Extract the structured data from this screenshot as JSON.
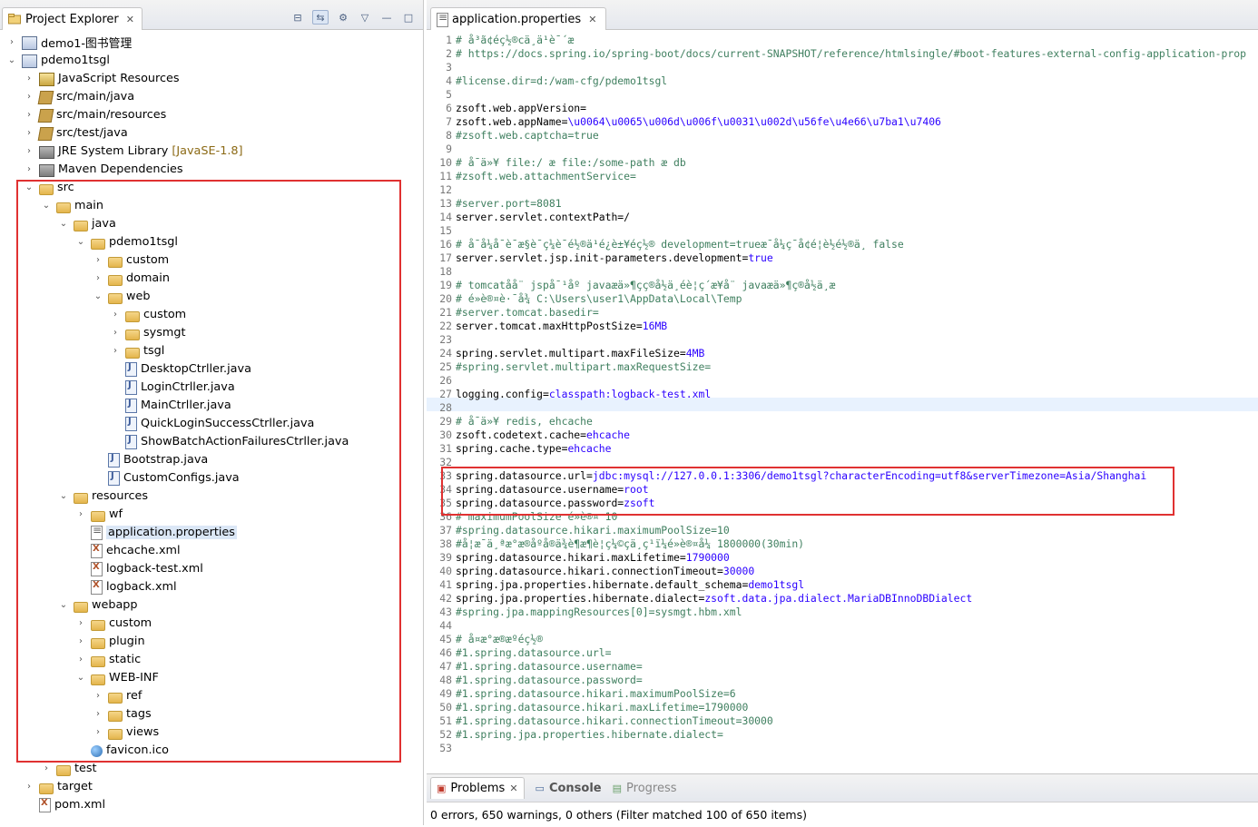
{
  "left": {
    "tab_title": "Project Explorer",
    "tree": [
      {
        "label": "demo1-图书管理",
        "icon": "project-icon",
        "tw": "›",
        "indent": 0
      },
      {
        "label": "pdemo1tsgl",
        "icon": "project-icon",
        "tw": "⌄",
        "indent": 0
      },
      {
        "label": "JavaScript Resources",
        "icon": "jsres-icon",
        "tw": "›",
        "indent": 1
      },
      {
        "label": "src/main/java",
        "icon": "package-icon",
        "tw": "›",
        "indent": 1
      },
      {
        "label": "src/main/resources",
        "icon": "package-icon",
        "tw": "›",
        "indent": 1
      },
      {
        "label": "src/test/java",
        "icon": "package-icon",
        "tw": "›",
        "indent": 1
      },
      {
        "label": "JRE System Library",
        "decoration": "[JavaSE-1.8]",
        "icon": "library-icon",
        "tw": "›",
        "indent": 1
      },
      {
        "label": "Maven Dependencies",
        "icon": "library-icon",
        "tw": "›",
        "indent": 1
      },
      {
        "label": "src",
        "icon": "folder-icon",
        "tw": "⌄",
        "indent": 1
      },
      {
        "label": "main",
        "icon": "folder-icon",
        "tw": "⌄",
        "indent": 2
      },
      {
        "label": "java",
        "icon": "folder-icon",
        "tw": "⌄",
        "indent": 3
      },
      {
        "label": "pdemo1tsgl",
        "icon": "folder-icon",
        "tw": "⌄",
        "indent": 4
      },
      {
        "label": "custom",
        "icon": "folder-icon",
        "tw": "›",
        "indent": 5
      },
      {
        "label": "domain",
        "icon": "folder-icon",
        "tw": "›",
        "indent": 5
      },
      {
        "label": "web",
        "icon": "folder-icon",
        "tw": "⌄",
        "indent": 5
      },
      {
        "label": "custom",
        "icon": "folder-icon",
        "tw": "›",
        "indent": 6
      },
      {
        "label": "sysmgt",
        "icon": "folder-icon",
        "tw": "›",
        "indent": 6
      },
      {
        "label": "tsgl",
        "icon": "folder-icon",
        "tw": "›",
        "indent": 6
      },
      {
        "label": "DesktopCtrller.java",
        "icon": "java-file-icon",
        "tw": "",
        "indent": 6
      },
      {
        "label": "LoginCtrller.java",
        "icon": "java-file-icon",
        "tw": "",
        "indent": 6
      },
      {
        "label": "MainCtrller.java",
        "icon": "java-file-icon",
        "tw": "",
        "indent": 6
      },
      {
        "label": "QuickLoginSuccessCtrller.java",
        "icon": "java-file-icon",
        "tw": "",
        "indent": 6
      },
      {
        "label": "ShowBatchActionFailuresCtrller.java",
        "icon": "java-file-icon",
        "tw": "",
        "indent": 6
      },
      {
        "label": "Bootstrap.java",
        "icon": "java-file-icon",
        "tw": "",
        "indent": 5
      },
      {
        "label": "CustomConfigs.java",
        "icon": "java-file-icon",
        "tw": "",
        "indent": 5
      },
      {
        "label": "resources",
        "icon": "folder-icon",
        "tw": "⌄",
        "indent": 3
      },
      {
        "label": "wf",
        "icon": "folder-icon",
        "tw": "›",
        "indent": 4
      },
      {
        "label": "application.properties",
        "icon": "properties-file-icon",
        "tw": "",
        "indent": 4,
        "selected": true
      },
      {
        "label": "ehcache.xml",
        "icon": "xml-file-icon",
        "tw": "",
        "indent": 4
      },
      {
        "label": "logback-test.xml",
        "icon": "xml-file-icon",
        "tw": "",
        "indent": 4
      },
      {
        "label": "logback.xml",
        "icon": "xml-file-icon",
        "tw": "",
        "indent": 4
      },
      {
        "label": "webapp",
        "icon": "folder-icon",
        "tw": "⌄",
        "indent": 3
      },
      {
        "label": "custom",
        "icon": "folder-icon",
        "tw": "›",
        "indent": 4
      },
      {
        "label": "plugin",
        "icon": "folder-icon",
        "tw": "›",
        "indent": 4
      },
      {
        "label": "static",
        "icon": "folder-icon",
        "tw": "›",
        "indent": 4
      },
      {
        "label": "WEB-INF",
        "icon": "folder-icon",
        "tw": "⌄",
        "indent": 4
      },
      {
        "label": "ref",
        "icon": "folder-icon",
        "tw": "›",
        "indent": 5
      },
      {
        "label": "tags",
        "icon": "folder-icon",
        "tw": "›",
        "indent": 5
      },
      {
        "label": "views",
        "icon": "folder-icon",
        "tw": "›",
        "indent": 5
      },
      {
        "label": "favicon.ico",
        "icon": "globe-icon",
        "tw": "",
        "indent": 4
      },
      {
        "label": "test",
        "icon": "folder-icon",
        "tw": "›",
        "indent": 2
      },
      {
        "label": "target",
        "icon": "folder-icon",
        "tw": "›",
        "indent": 1
      },
      {
        "label": "pom.xml",
        "icon": "xml-file-icon",
        "tw": "",
        "indent": 1
      }
    ]
  },
  "editor": {
    "tab_title": "application.properties",
    "lines": [
      {
        "n": "1",
        "parts": [
          [
            "cm",
            "# å³ã¢éç½®cä¸ä¹è¯´æ"
          ]
        ]
      },
      {
        "n": "2",
        "parts": [
          [
            "cm",
            "# https://docs.spring.io/spring-boot/docs/current-SNAPSHOT/reference/htmlsingle/#boot-features-external-config-application-prop"
          ]
        ]
      },
      {
        "n": "3",
        "parts": []
      },
      {
        "n": "4",
        "parts": [
          [
            "cm",
            "#license.dir=d:/wam-cfg/pdemo1tsgl"
          ]
        ]
      },
      {
        "n": "5",
        "parts": []
      },
      {
        "n": "6",
        "parts": [
          [
            "k",
            "zsoft.web.appVersion="
          ]
        ]
      },
      {
        "n": "7",
        "parts": [
          [
            "k",
            "zsoft.web.appName="
          ],
          [
            "v",
            "\\u0064\\u0065\\u006d\\u006f\\u0031\\u002d\\u56fe\\u4e66\\u7ba1\\u7406"
          ]
        ]
      },
      {
        "n": "8",
        "parts": [
          [
            "cm",
            "#zsoft.web.captcha=true"
          ]
        ]
      },
      {
        "n": "9",
        "parts": []
      },
      {
        "n": "10",
        "parts": [
          [
            "cm",
            "# å¯ä»¥ file:/ æ file:/some-path æ db"
          ]
        ]
      },
      {
        "n": "11",
        "parts": [
          [
            "cm",
            "#zsoft.web.attachmentService="
          ]
        ]
      },
      {
        "n": "12",
        "parts": []
      },
      {
        "n": "13",
        "parts": [
          [
            "cm",
            "#server.port=8081"
          ]
        ]
      },
      {
        "n": "14",
        "parts": [
          [
            "k",
            "server.servlet.contextPath=/"
          ]
        ]
      },
      {
        "n": "15",
        "parts": []
      },
      {
        "n": "16",
        "parts": [
          [
            "cm",
            "# å¯å¼å¯è¯æ§è¯ç¼è¯é½®ä¹é¿è±¥éç½® development=trueæ¯å¼ç¯å¢é¦è½é½®ä¸ false"
          ]
        ]
      },
      {
        "n": "17",
        "parts": [
          [
            "k",
            "server.servlet.jsp.init-parameters.development="
          ],
          [
            "v",
            "true"
          ]
        ]
      },
      {
        "n": "18",
        "parts": []
      },
      {
        "n": "19",
        "parts": [
          [
            "cm",
            "# tomcatå­å¨ jspå¯¹åº javaæä»¶çç®å½ä¸éè¦ç´æ¥å¨ javaæä»¶ç®å½ä¸æ"
          ]
        ]
      },
      {
        "n": "20",
        "parts": [
          [
            "cm",
            "# é»è®¤è·¯å¾ C:\\Users\\user1\\AppData\\Local\\Temp"
          ]
        ]
      },
      {
        "n": "21",
        "parts": [
          [
            "cm",
            "#server.tomcat.basedir="
          ]
        ]
      },
      {
        "n": "22",
        "parts": [
          [
            "k",
            "server.tomcat.maxHttpPostSize="
          ],
          [
            "v",
            "16MB"
          ]
        ]
      },
      {
        "n": "23",
        "parts": []
      },
      {
        "n": "24",
        "parts": [
          [
            "k",
            "spring.servlet.multipart.maxFileSize="
          ],
          [
            "v",
            "4MB"
          ]
        ]
      },
      {
        "n": "25",
        "parts": [
          [
            "cm",
            "#spring.servlet.multipart.maxRequestSize="
          ]
        ]
      },
      {
        "n": "26",
        "parts": []
      },
      {
        "n": "27",
        "parts": [
          [
            "k",
            "logging.config="
          ],
          [
            "v",
            "classpath:logback-test.xml"
          ]
        ]
      },
      {
        "n": "28",
        "parts": []
      },
      {
        "n": "29",
        "parts": [
          [
            "cm",
            "# å¯ä»¥ redis, ehcache"
          ]
        ]
      },
      {
        "n": "30",
        "parts": [
          [
            "k",
            "zsoft.codetext.cache="
          ],
          [
            "v",
            "ehcache"
          ]
        ]
      },
      {
        "n": "31",
        "parts": [
          [
            "k",
            "spring.cache.type="
          ],
          [
            "v",
            "ehcache"
          ]
        ]
      },
      {
        "n": "32",
        "parts": []
      },
      {
        "n": "33",
        "parts": [
          [
            "k",
            "spring.datasource.url="
          ],
          [
            "v",
            "jdbc:mysql://127.0.0.1:3306/demo1tsgl?characterEncoding=utf8&serverTimezone=Asia/Shanghai"
          ]
        ]
      },
      {
        "n": "34",
        "parts": [
          [
            "k",
            "spring.datasource.username="
          ],
          [
            "v",
            "root"
          ]
        ]
      },
      {
        "n": "35",
        "parts": [
          [
            "k",
            "spring.datasource.password="
          ],
          [
            "v",
            "zsoft"
          ]
        ]
      },
      {
        "n": "36",
        "parts": [
          [
            "cm",
            "# maximumPoolSize é»è®¤ 10"
          ]
        ]
      },
      {
        "n": "37",
        "parts": [
          [
            "cm",
            "#spring.datasource.hikari.maximumPoolSize=10"
          ]
        ]
      },
      {
        "n": "38",
        "parts": [
          [
            "cm",
            "#å¦æ¯ä¸ªæ°æ®åºå®ä¾è¶æ¶è¦ç¼©ç­ä¸ç¹ï¼é»è®¤å¼ 1800000(30min)"
          ]
        ]
      },
      {
        "n": "39",
        "parts": [
          [
            "k",
            "spring.datasource.hikari.maxLifetime="
          ],
          [
            "v",
            "1790000"
          ]
        ]
      },
      {
        "n": "40",
        "parts": [
          [
            "k",
            "spring.datasource.hikari.connectionTimeout="
          ],
          [
            "v",
            "30000"
          ]
        ]
      },
      {
        "n": "41",
        "parts": [
          [
            "k",
            "spring.jpa.properties.hibernate.default_schema="
          ],
          [
            "v",
            "demo1tsgl"
          ]
        ]
      },
      {
        "n": "42",
        "parts": [
          [
            "k",
            "spring.jpa.properties.hibernate.dialect="
          ],
          [
            "v",
            "zsoft.data.jpa.dialect.MariaDBInnoDBDialect"
          ]
        ]
      },
      {
        "n": "43",
        "parts": [
          [
            "cm",
            "#spring.jpa.mappingResources[0]=sysmgt.hbm.xml"
          ]
        ]
      },
      {
        "n": "44",
        "parts": []
      },
      {
        "n": "45",
        "parts": [
          [
            "cm",
            "# å¤æ°æ®æºéç½®"
          ]
        ]
      },
      {
        "n": "46",
        "parts": [
          [
            "cm",
            "#1.spring.datasource.url="
          ]
        ]
      },
      {
        "n": "47",
        "parts": [
          [
            "cm",
            "#1.spring.datasource.username="
          ]
        ]
      },
      {
        "n": "48",
        "parts": [
          [
            "cm",
            "#1.spring.datasource.password="
          ]
        ]
      },
      {
        "n": "49",
        "parts": [
          [
            "cm",
            "#1.spring.datasource.hikari.maximumPoolSize=6"
          ]
        ]
      },
      {
        "n": "50",
        "parts": [
          [
            "cm",
            "#1.spring.datasource.hikari.maxLifetime=1790000"
          ]
        ]
      },
      {
        "n": "51",
        "parts": [
          [
            "cm",
            "#1.spring.datasource.hikari.connectionTimeout=30000"
          ]
        ]
      },
      {
        "n": "52",
        "parts": [
          [
            "cm",
            "#1.spring.jpa.properties.hibernate.dialect="
          ]
        ]
      },
      {
        "n": "53",
        "parts": []
      }
    ]
  },
  "bottom": {
    "tabs": [
      {
        "label": "Problems",
        "icon": "problems-icon"
      },
      {
        "label": "Console",
        "icon": "console-icon"
      },
      {
        "label": "Progress",
        "icon": "progress-icon"
      }
    ],
    "summary": "0 errors, 650 warnings, 0 others (Filter matched 100 of 650 items)"
  },
  "colors": {
    "comment": "#3f7f5f",
    "value": "#2a00ff",
    "highlight": "#e03131",
    "selection": "#dbe7f6"
  }
}
